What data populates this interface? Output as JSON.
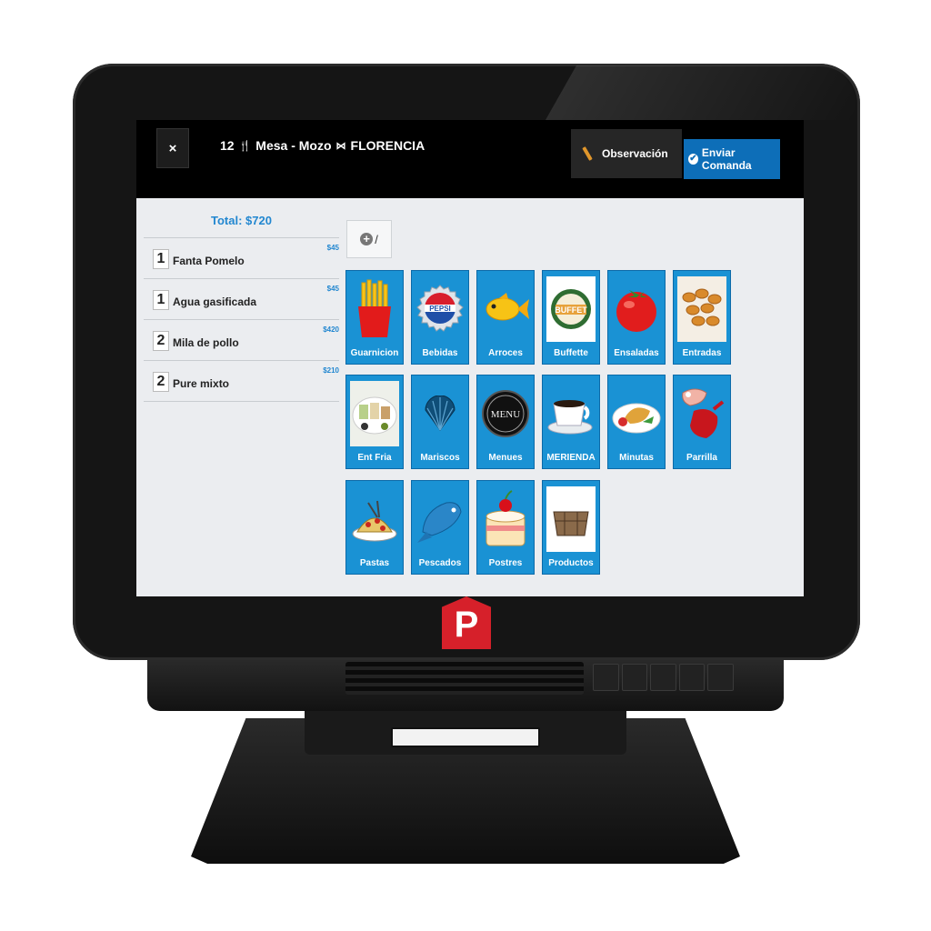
{
  "header": {
    "close_label": "×",
    "table_number": "12",
    "title_text": "Mesa - Mozo",
    "waiter": "FLORENCIA",
    "observacion_label": "Observación",
    "enviar_label": "Enviar Comanda"
  },
  "order": {
    "total": "Total: $720",
    "items": [
      {
        "qty": "1",
        "name": "Fanta Pomelo",
        "price": "$45"
      },
      {
        "qty": "1",
        "name": "Agua gasificada",
        "price": "$45"
      },
      {
        "qty": "2",
        "name": "Mila de pollo",
        "price": "$420"
      },
      {
        "qty": "2",
        "name": "Pure mixto",
        "price": "$210"
      }
    ]
  },
  "add_box": {
    "symbol": "+",
    "separator": "/"
  },
  "categories": [
    {
      "label": "Guarnicion",
      "icon": "fries-icon"
    },
    {
      "label": "Bebidas",
      "icon": "bottle-cap-icon"
    },
    {
      "label": "Arroces",
      "icon": "fish-icon"
    },
    {
      "label": "Buffette",
      "icon": "buffet-badge-icon",
      "badge_text": "BUFFET"
    },
    {
      "label": "Ensaladas",
      "icon": "tomato-icon"
    },
    {
      "label": "Entradas",
      "icon": "fried-shrimp-icon"
    },
    {
      "label": "Ent Fria",
      "icon": "cold-platter-icon"
    },
    {
      "label": "Mariscos",
      "icon": "shell-icon"
    },
    {
      "label": "Menues",
      "icon": "menu-badge-icon",
      "badge_text": "MENU"
    },
    {
      "label": "MERIENDA",
      "icon": "coffee-cup-icon"
    },
    {
      "label": "Minutas",
      "icon": "plate-icon"
    },
    {
      "label": "Parrilla",
      "icon": "grill-meat-icon"
    },
    {
      "label": "Pastas",
      "icon": "pasta-icon"
    },
    {
      "label": "Pescados",
      "icon": "blue-fish-icon"
    },
    {
      "label": "Postres",
      "icon": "cake-icon"
    },
    {
      "label": "Productos",
      "icon": "crate-icon"
    }
  ],
  "device": {
    "logo_letter": "P"
  },
  "colors": {
    "accent": "#1a92d4",
    "send_button": "#0d6eb8",
    "logo": "#d6202a",
    "total_text": "#2287d0"
  }
}
